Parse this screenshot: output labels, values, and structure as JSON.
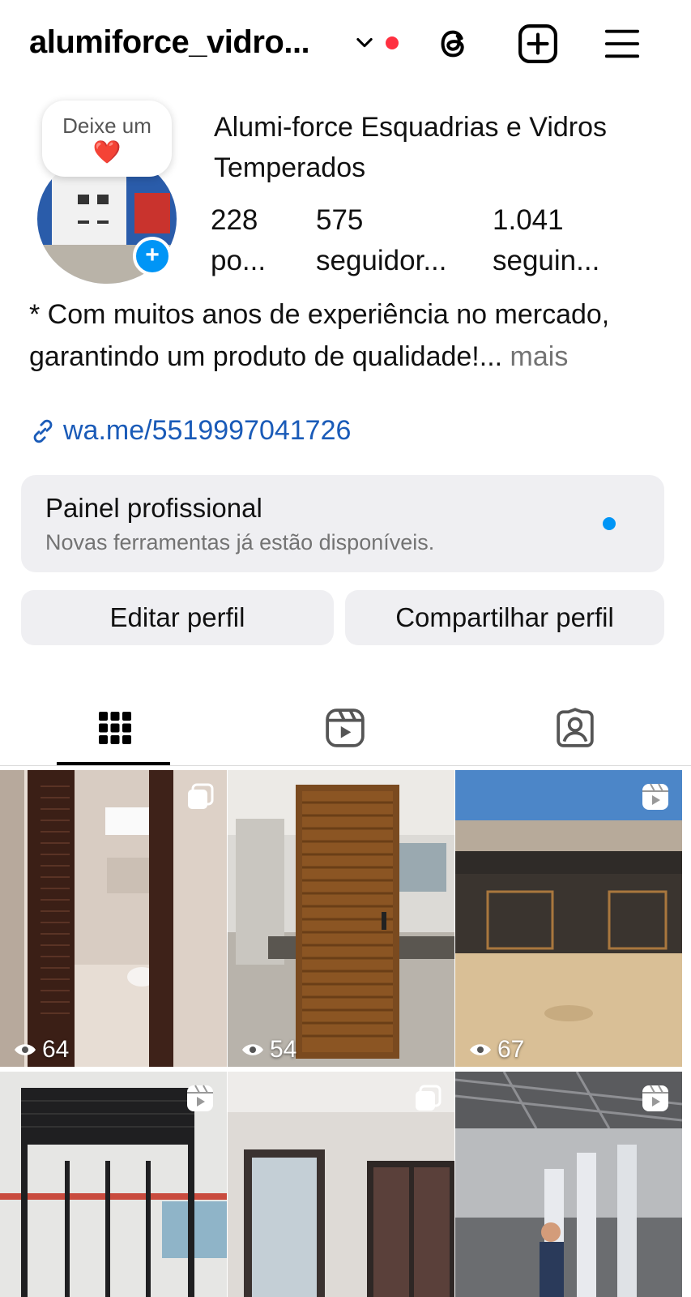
{
  "header": {
    "username": "alumiforce_vidro...",
    "icons": [
      "chevron-down-icon",
      "threads-icon",
      "create-plus-icon",
      "hamburger-menu-icon"
    ],
    "notification_color": "#ff3040"
  },
  "profile": {
    "note_text": "Deixe um",
    "note_emoji": "❤️",
    "display_name": "Alumi-force Esquadrias e Vidros Temperados",
    "stats": [
      {
        "value": "228",
        "label": "po..."
      },
      {
        "value": "575",
        "label": "seguidor..."
      },
      {
        "value": "1.041",
        "label": "seguin..."
      }
    ],
    "bio": "* Com muitos anos de experiência no mercado, garantindo um produto de qualidade!...",
    "bio_more": " mais",
    "link": "wa.me/5519997041726"
  },
  "panel": {
    "title": "Painel profissional",
    "subtitle": "Novas ferramentas já estão disponíveis.",
    "accent": "#0095f6"
  },
  "buttons": {
    "edit": "Editar perfil",
    "share": "Compartilhar perfil"
  },
  "tabs": [
    "grid-icon",
    "reels-icon",
    "tagged-icon"
  ],
  "grid": [
    {
      "type": "carousel",
      "views": "64"
    },
    {
      "type": "photo",
      "views": "54"
    },
    {
      "type": "reel",
      "views": "67"
    },
    {
      "type": "reel",
      "views": ""
    },
    {
      "type": "carousel",
      "views": ""
    },
    {
      "type": "reel",
      "views": ""
    }
  ]
}
